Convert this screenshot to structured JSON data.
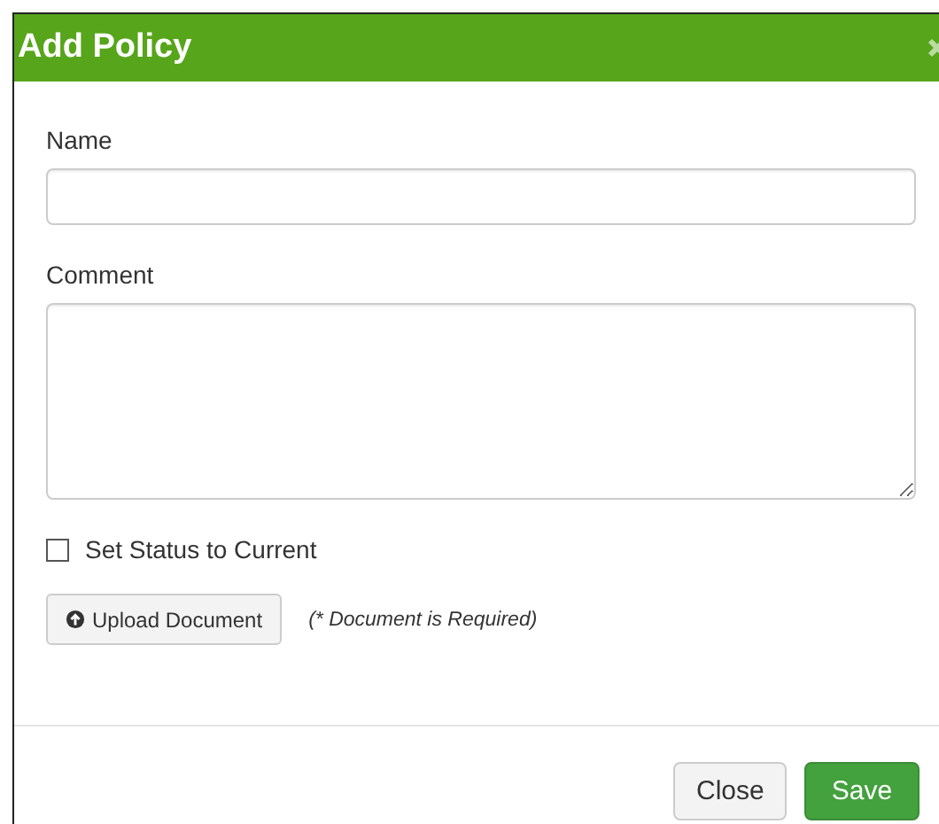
{
  "dialog": {
    "title": "Add Policy"
  },
  "fields": [
    {
      "label": "Name",
      "kind": "input"
    },
    {
      "label": "Comment",
      "kind": "textarea"
    }
  ],
  "status_checkbox": {
    "label": "Set Status to Current",
    "checked": false
  },
  "upload": {
    "button": "Upload Document",
    "note": "(* Document is Required)"
  },
  "buttons": [
    {
      "label": "Close",
      "kind": "default"
    },
    {
      "label": "Save",
      "kind": "primary"
    }
  ]
}
